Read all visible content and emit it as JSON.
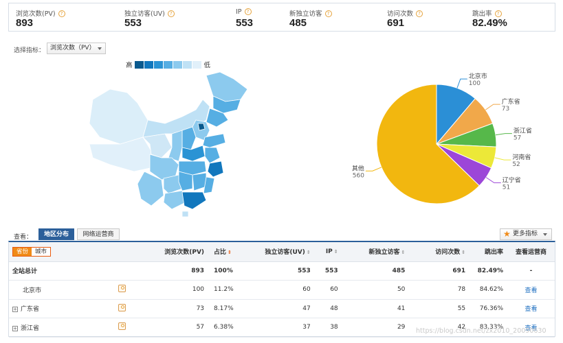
{
  "stats": [
    {
      "label": "浏览次数(PV)",
      "value": "893"
    },
    {
      "label": "独立访客(UV)",
      "value": "553"
    },
    {
      "label": "IP",
      "value": "553"
    },
    {
      "label": "新独立访客",
      "value": "485"
    },
    {
      "label": "访问次数",
      "value": "691"
    },
    {
      "label": "跳出率",
      "value": "82.49%"
    }
  ],
  "indicator": {
    "label": "选择指标：",
    "selected": "浏览次数（PV）"
  },
  "legend": {
    "high": "高",
    "low": "低",
    "colors": [
      "#0b5a8e",
      "#1177bd",
      "#2a93d4",
      "#56aee3",
      "#8ccaee",
      "#bfe1f5",
      "#e1f0fa"
    ]
  },
  "chart_data": {
    "type": "pie",
    "series": [
      {
        "name": "北京市",
        "value": 100,
        "color": "#2b8fd6"
      },
      {
        "name": "广东省",
        "value": 73,
        "color": "#f1a84a"
      },
      {
        "name": "浙江省",
        "value": 57,
        "color": "#56b84a"
      },
      {
        "name": "河南省",
        "value": 52,
        "color": "#ece838"
      },
      {
        "name": "辽宁省",
        "value": 51,
        "color": "#9c46d8"
      },
      {
        "name": "其他",
        "value": 560,
        "color": "#f2b70f"
      }
    ]
  },
  "tabs": {
    "view_label": "查看：",
    "region": "地区分布",
    "isp": "网络运营商"
  },
  "more_button": "更多指标",
  "table": {
    "toggle": {
      "province": "省份",
      "city": "城市"
    },
    "headers": [
      "浏览次数(PV)",
      "占比",
      "独立访客(UV)",
      "IP",
      "新独立访客",
      "访问次数",
      "跳出率",
      "查看运营商"
    ],
    "total": {
      "name": "全站总计",
      "cells": [
        "893",
        "100%",
        "553",
        "553",
        "485",
        "691",
        "82.49%",
        "-"
      ]
    },
    "rows": [
      {
        "name": "北京市",
        "expandable": false,
        "cells": [
          "100",
          "11.2%",
          "60",
          "60",
          "50",
          "78",
          "84.62%",
          "查看"
        ]
      },
      {
        "name": "广东省",
        "expandable": true,
        "cells": [
          "73",
          "8.17%",
          "47",
          "48",
          "41",
          "55",
          "76.36%",
          "查看"
        ]
      },
      {
        "name": "浙江省",
        "expandable": true,
        "cells": [
          "57",
          "6.38%",
          "37",
          "38",
          "29",
          "42",
          "83.33%",
          "查看"
        ]
      }
    ]
  },
  "watermark": "https://blog.csdn.net/zx2010_20090630"
}
